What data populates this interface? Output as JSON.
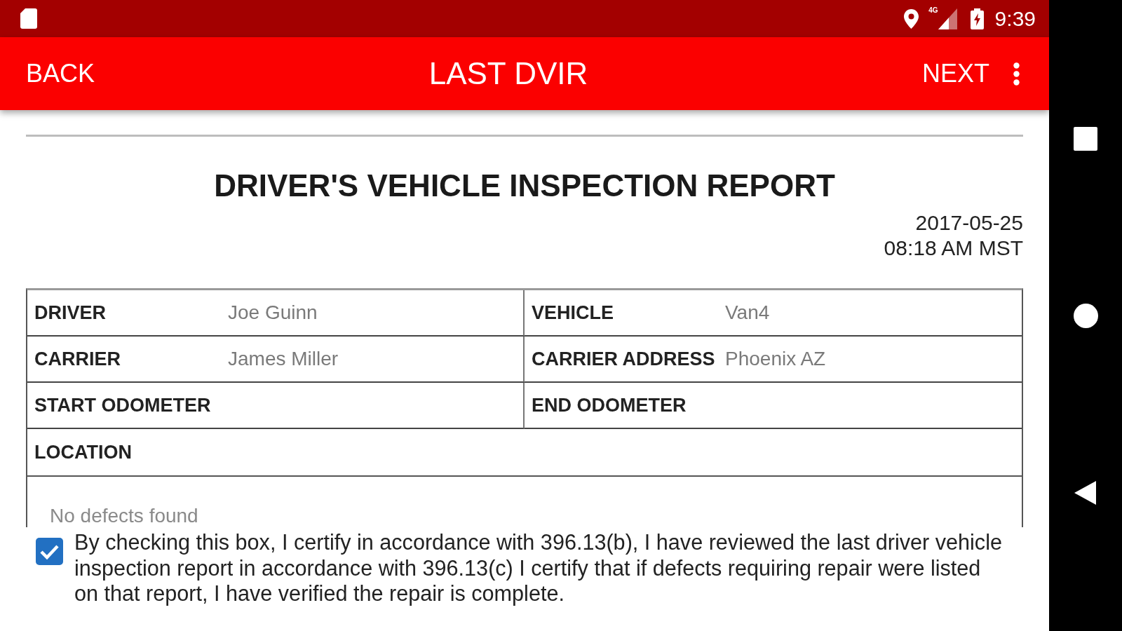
{
  "status_bar": {
    "network": "4G",
    "time": "9:39"
  },
  "app_bar": {
    "back": "BACK",
    "title": "LAST DVIR",
    "next": "NEXT"
  },
  "report": {
    "title": "DRIVER'S VEHICLE INSPECTION REPORT",
    "date": "2017-05-25",
    "time": "08:18 AM MST",
    "rows": [
      {
        "cells": [
          {
            "label": "DRIVER",
            "value": "Joe Guinn"
          },
          {
            "label": "VEHICLE",
            "value": "Van4"
          }
        ]
      },
      {
        "cells": [
          {
            "label": "CARRIER",
            "value": "James Miller"
          },
          {
            "label": "CARRIER ADDRESS",
            "value": "Phoenix AZ"
          }
        ]
      },
      {
        "cells": [
          {
            "label": "START ODOMETER"
          },
          {
            "label": "END ODOMETER"
          }
        ]
      },
      {
        "cells": [
          {
            "label": "LOCATION"
          }
        ]
      }
    ],
    "defects": "No defects found"
  },
  "certification": {
    "checked": true,
    "text": "By checking this box, I certify in accordance with 396.13(b), I have reviewed the last driver vehicle inspection report in accordance with 396.13(c) I certify that if defects requiring repair were listed on that report, I have verified the repair is complete."
  }
}
